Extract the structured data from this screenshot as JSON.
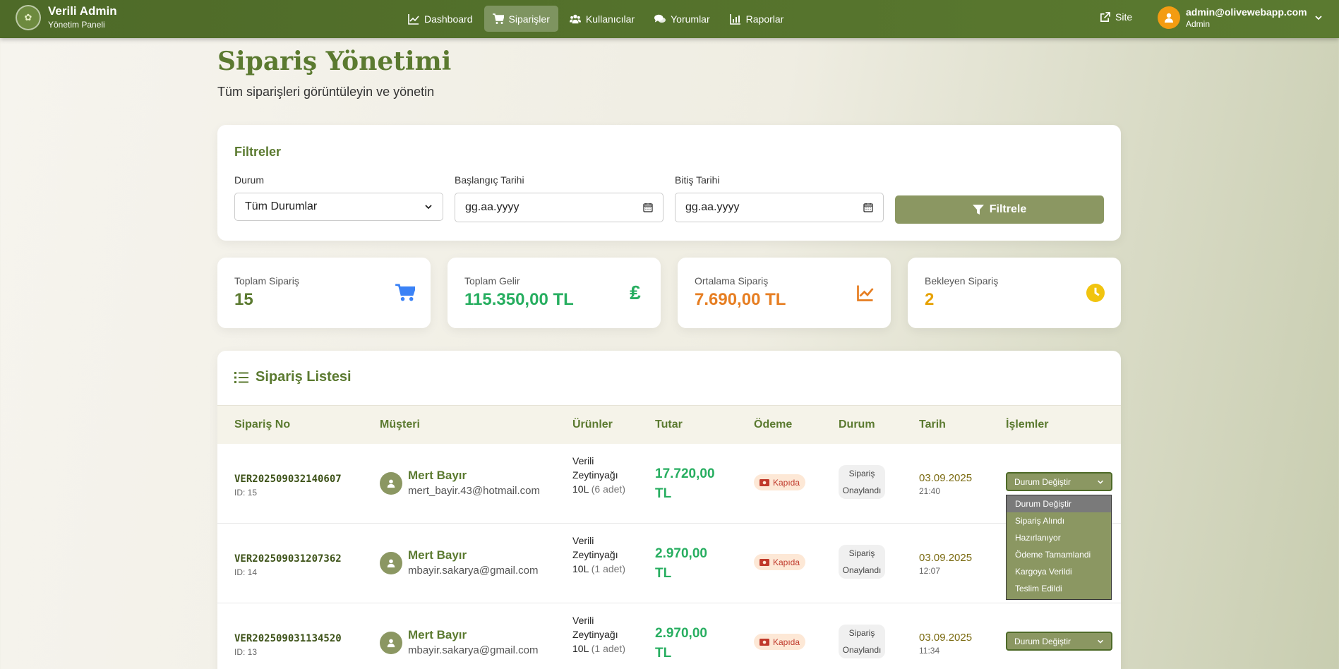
{
  "brand": {
    "title": "Verili Admin",
    "subtitle": "Yönetim Paneli"
  },
  "nav": {
    "items": [
      {
        "label": "Dashboard",
        "icon": "chart-line-icon",
        "active": false
      },
      {
        "label": "Siparişler",
        "icon": "cart-icon",
        "active": true
      },
      {
        "label": "Kullanıcılar",
        "icon": "users-icon",
        "active": false
      },
      {
        "label": "Yorumlar",
        "icon": "comments-icon",
        "active": false
      },
      {
        "label": "Raporlar",
        "icon": "chart-bar-icon",
        "active": false
      }
    ],
    "site_label": "Site",
    "user_email": "admin@olivewebapp.com",
    "user_role": "Admin"
  },
  "page": {
    "title": "Sipariş Yönetimi",
    "subtitle": "Tüm siparişleri görüntüleyin ve yönetin"
  },
  "filters": {
    "title": "Filtreler",
    "status_label": "Durum",
    "status_value": "Tüm Durumlar",
    "start_label": "Başlangıç Tarihi",
    "start_placeholder": "gg.aa.yyyy",
    "end_label": "Bitiş Tarihi",
    "end_placeholder": "gg.aa.yyyy",
    "button": "Filtrele"
  },
  "stats": [
    {
      "label": "Toplam Sipariş",
      "value": "15",
      "color": "#5b7a30",
      "icon": "cart-icon"
    },
    {
      "label": "Toplam Gelir",
      "value": "115.350,00 TL",
      "color": "#27ae60",
      "icon": "lira-icon"
    },
    {
      "label": "Ortalama Sipariş",
      "value": "7.690,00 TL",
      "color": "#e67e22",
      "icon": "chart-line-icon"
    },
    {
      "label": "Bekleyen Sipariş",
      "value": "2",
      "color": "#e6a100",
      "icon": "clock-icon"
    }
  ],
  "orders": {
    "title": "Sipariş Listesi",
    "columns": [
      "Sipariş No",
      "Müşteri",
      "Ürünler",
      "Tutar",
      "Ödeme",
      "Durum",
      "Tarih",
      "İşlemler"
    ],
    "rows": [
      {
        "no": "VER202509032140607",
        "id": "ID: 15",
        "customer": "Mert Bayır",
        "email": "mert_bayir.43@hotmail.com",
        "product": "Verili Zeytinyağı 10L",
        "qty": "(6 adet)",
        "amount": "17.720,00 TL",
        "payment": "Kapıda",
        "status": "Sipariş Onaylandı",
        "date": "03.09.2025",
        "time": "21:40",
        "action": "Durum Değiştir"
      },
      {
        "no": "VER202509031207362",
        "id": "ID: 14",
        "customer": "Mert Bayır",
        "email": "mbayir.sakarya@gmail.com",
        "product": "Verili Zeytinyağı 10L",
        "qty": "(1 adet)",
        "amount": "2.970,00 TL",
        "payment": "Kapıda",
        "status": "Sipariş Onaylandı",
        "date": "03.09.2025",
        "time": "12:07",
        "action": "Durum Değiştir"
      },
      {
        "no": "VER202509031134520",
        "id": "ID: 13",
        "customer": "Mert Bayır",
        "email": "mbayir.sakarya@gmail.com",
        "product": "Verili Zeytinyağı 10L",
        "qty": "(1 adet)",
        "amount": "2.970,00 TL",
        "payment": "Kapıda",
        "status": "Sipariş Onaylandı",
        "date": "03.09.2025",
        "time": "11:34",
        "action": "Durum Değiştir"
      }
    ]
  },
  "status_dropdown": {
    "options": [
      "Durum Değiştir",
      "Sipariş Alındı",
      "Hazırlanıyor",
      "Ödeme Tamamlandi",
      "Kargoya Verildi",
      "Teslim Edildi"
    ],
    "selected": "Durum Değiştir"
  }
}
